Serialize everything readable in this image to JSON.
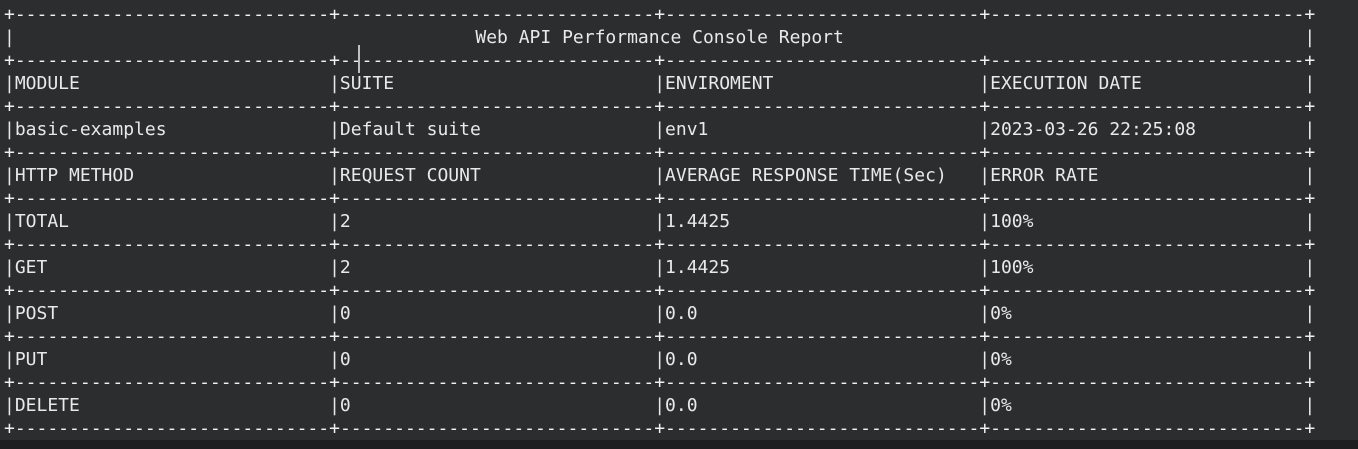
{
  "title": "Web API Performance Console Report",
  "colors": {
    "background": "#2b2d2e",
    "text": "#e9e9e9",
    "border": "#f1f1f1",
    "footer_strip": "#1c1e1f",
    "cursor": "#cdd1d3"
  },
  "suite_table": {
    "headers": [
      "MODULE",
      "SUITE",
      "ENVIROMENT",
      "EXECUTION DATE"
    ],
    "rows": [
      [
        "basic-examples",
        "Default suite",
        "env1",
        "2023-03-26 22:25:08"
      ]
    ]
  },
  "methods_table": {
    "headers": [
      "HTTP METHOD",
      "REQUEST COUNT",
      "AVERAGE RESPONSE TIME(Sec)",
      "ERROR RATE"
    ],
    "rows": [
      [
        "TOTAL",
        "2",
        "1.4425",
        "100%"
      ],
      [
        "GET",
        "2",
        "1.4425",
        "100%"
      ],
      [
        "POST",
        "0",
        "0.0",
        "0%"
      ],
      [
        "PUT",
        "0",
        "0.0",
        "0%"
      ],
      [
        "DELETE",
        "0",
        "0.0",
        "0%"
      ]
    ]
  }
}
